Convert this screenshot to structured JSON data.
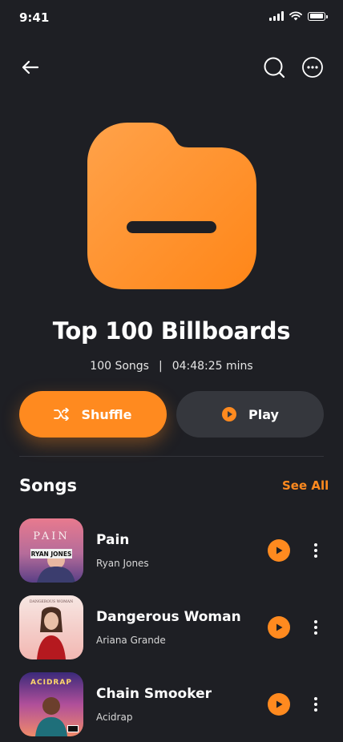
{
  "status": {
    "time": "9:41"
  },
  "icons": {
    "back": "arrow-left-icon",
    "search": "search-icon",
    "more": "more-horizontal-icon",
    "shuffle": "shuffle-icon",
    "play": "play-icon"
  },
  "colors": {
    "accent": "#ff8a1f",
    "background": "#1e1f24",
    "secondary_button": "#35373d"
  },
  "playlist": {
    "title": "Top 100 Billboards",
    "songs_count": "100 Songs",
    "separator": "|",
    "duration": "04:48:25 mins"
  },
  "actions": {
    "shuffle_label": "Shuffle",
    "play_label": "Play"
  },
  "songs_section": {
    "heading": "Songs",
    "see_all": "See All",
    "items": [
      {
        "title": "Pain",
        "artist": "Ryan Jones",
        "cover_text": "PAIN",
        "cover_sub": "RYAN JONES"
      },
      {
        "title": "Dangerous Woman",
        "artist": "Ariana Grande",
        "cover_text": "DANGEROUS WOMAN"
      },
      {
        "title": "Chain Smooker",
        "artist": "Acidrap",
        "cover_text": "ACIDRAP"
      }
    ]
  }
}
